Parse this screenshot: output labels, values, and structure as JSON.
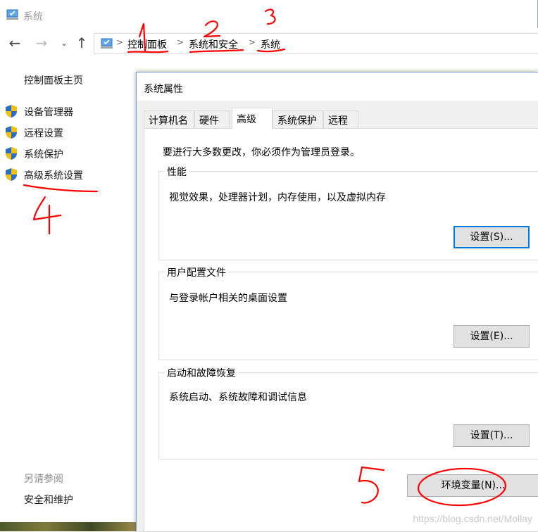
{
  "window": {
    "title": "系统",
    "icon": "system-icon"
  },
  "nav": {
    "back_icon": "←",
    "forward_icon": "→",
    "history_icon": "⌄",
    "up_icon": "↑"
  },
  "breadcrumb": {
    "items": [
      "控制面板",
      "系统和安全",
      "系统"
    ],
    "separator": ">"
  },
  "sidebar": {
    "home": "控制面板主页",
    "items": [
      {
        "label": "设备管理器",
        "icon": "uac-shield-icon"
      },
      {
        "label": "远程设置",
        "icon": "uac-shield-icon"
      },
      {
        "label": "系统保护",
        "icon": "uac-shield-icon"
      },
      {
        "label": "高级系统设置",
        "icon": "uac-shield-icon"
      }
    ],
    "see_also": "另请参阅",
    "security_link": "安全和维护"
  },
  "dialog": {
    "title": "系统属性",
    "tabs": [
      "计算机名",
      "硬件",
      "高级",
      "系统保护",
      "远程"
    ],
    "active_tab": "高级",
    "admin_note": "要进行大多数更改，你必须作为管理员登录。",
    "groups": [
      {
        "title": "性能",
        "desc": "视觉效果，处理器计划，内存使用，以及虚拟内存",
        "button": "设置(S)..."
      },
      {
        "title": "用户配置文件",
        "desc": "与登录帐户相关的桌面设置",
        "button": "设置(E)..."
      },
      {
        "title": "启动和故障恢复",
        "desc": "系统启动、系统故障和调试信息",
        "button": "设置(T)..."
      }
    ],
    "env_button": "环境变量(N)..."
  },
  "annotations": {
    "numbers": [
      "1",
      "2",
      "3",
      "4",
      "5"
    ],
    "color": "#ff0000"
  },
  "watermark": "https://blog.csdn.net/Mollay",
  "colors": {
    "accent": "#0078d7",
    "shield_blue": "#2b6cc4",
    "shield_gold": "#f2c10f"
  }
}
